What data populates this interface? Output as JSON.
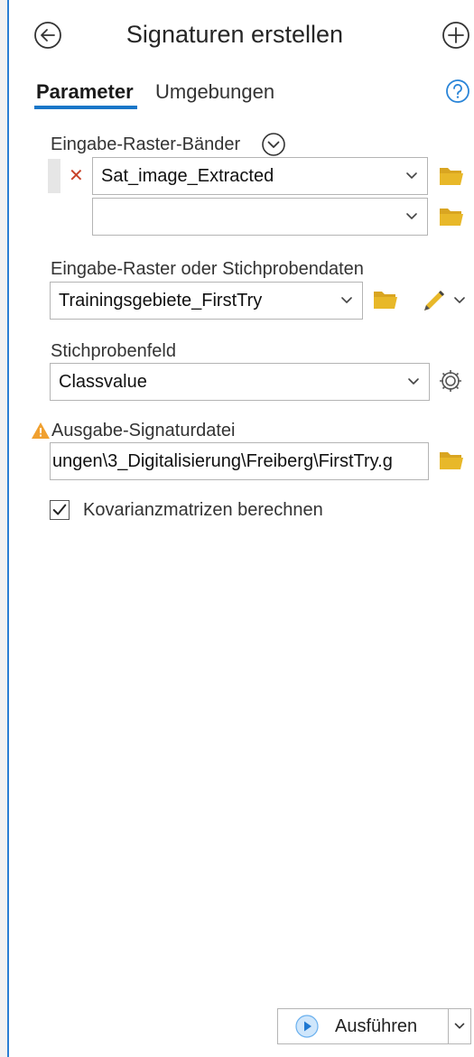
{
  "header": {
    "title": "Signaturen erstellen",
    "back_icon": "back-circle-icon",
    "add_icon": "add-circle-icon"
  },
  "tabs": [
    {
      "label": "Parameter",
      "active": true
    },
    {
      "label": "Umgebungen",
      "active": false
    }
  ],
  "help_icon": "help-icon",
  "params": {
    "raster_bands": {
      "label": "Eingabe-Raster-Bänder",
      "expand_icon": "chevron-down-circle-icon",
      "items": [
        {
          "value": "Sat_image_Extracted",
          "removable": true
        },
        {
          "value": "",
          "removable": false
        }
      ]
    },
    "sample_data": {
      "label": "Eingabe-Raster oder Stichprobendaten",
      "value": "Trainingsgebiete_FirstTry"
    },
    "sample_field": {
      "label": "Stichprobenfeld",
      "value": "Classvalue"
    },
    "output": {
      "label": "Ausgabe-Signaturdatei",
      "value": "ungen\\3_Digitalisierung\\Freiberg\\FirstTry.g",
      "warning_icon": "warning-icon"
    },
    "covariance": {
      "label": "Kovarianzmatrizen berechnen",
      "checked": true
    }
  },
  "footer": {
    "run_label": "Ausführen"
  },
  "colors": {
    "accent": "#1976c8",
    "folder": "#e8b829",
    "remove": "#c8432a",
    "warning": "#f0a030"
  }
}
